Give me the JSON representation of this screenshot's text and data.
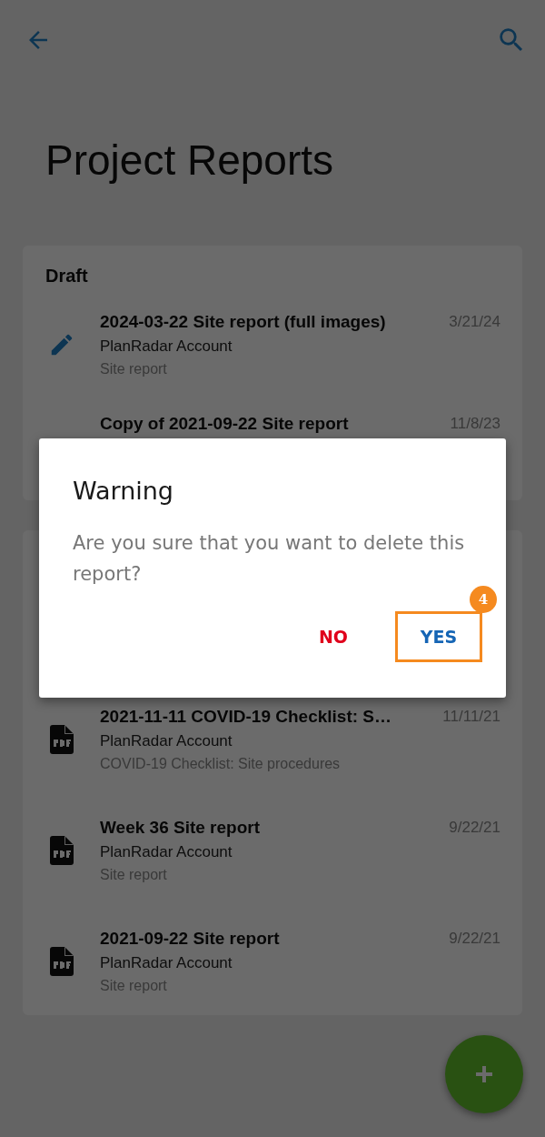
{
  "title": "Project Reports",
  "sections": [
    {
      "heading": "Draft",
      "reports": [
        {
          "kind": "draft",
          "title": "2024-03-22 Site report (full images)",
          "account": "PlanRadar Account",
          "type": "Site report",
          "date": "3/21/24"
        },
        {
          "title": "Copy of 2021-09-22 Site report",
          "date": "11/8/23"
        }
      ]
    },
    {
      "reports": [
        {
          "kind": "pdf",
          "title": "2021-11-11 COVID-19 Checklist: S…",
          "account": "PlanRadar Account",
          "type": "COVID-19 Checklist: Site procedures",
          "date": "11/11/21"
        },
        {
          "kind": "pdf",
          "title": "Week 36 Site report",
          "account": "PlanRadar Account",
          "type": "Site report",
          "date": "9/22/21"
        },
        {
          "kind": "pdf",
          "title": "2021-09-22 Site report",
          "account": "PlanRadar Account",
          "type": "Site report",
          "date": "9/22/21"
        }
      ]
    }
  ],
  "dialog": {
    "title": "Warning",
    "message": "Are you sure that you want to delete this report?",
    "buttons": [
      {
        "label": "NO",
        "kind": "negative",
        "highlighted": false
      },
      {
        "label": "YES",
        "kind": "positive",
        "highlighted": true,
        "badge": "4"
      }
    ]
  }
}
